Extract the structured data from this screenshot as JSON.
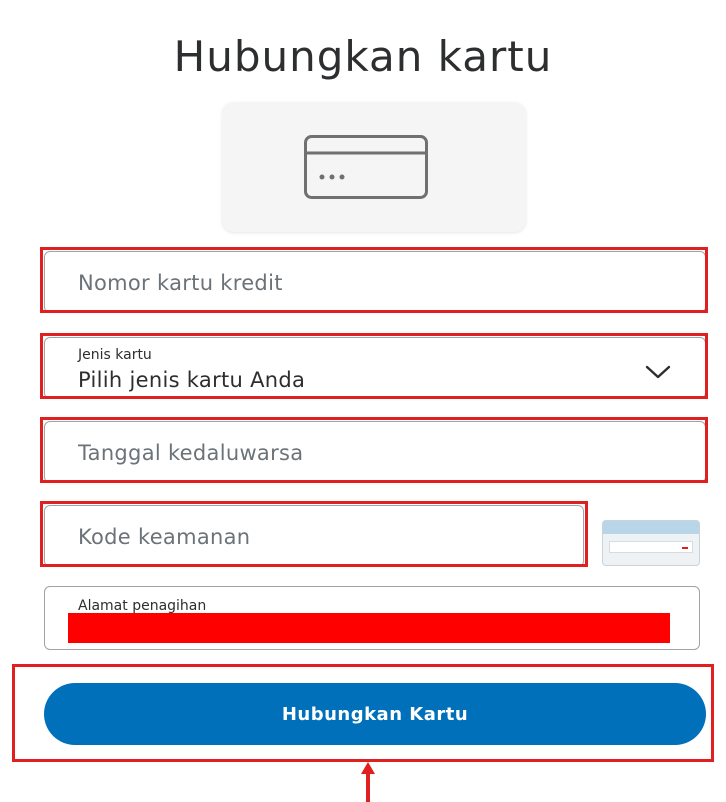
{
  "page": {
    "title": "Hubungkan kartu"
  },
  "form": {
    "card_number_placeholder": "Nomor kartu kredit",
    "card_type": {
      "label": "Jenis kartu",
      "value": "Pilih jenis kartu Anda"
    },
    "expiry_placeholder": "Tanggal kedaluwarsa",
    "security_code_placeholder": "Kode keamanan",
    "billing_address": {
      "label": "Alamat penagihan",
      "value_redacted": true
    },
    "submit_label": "Hubungkan Kartu"
  },
  "icons": {
    "card_tile": "credit-card-icon",
    "security_hint": "card-back-cvv-icon",
    "dropdown": "chevron-down-icon",
    "annotation_arrow": "up-arrow-icon"
  },
  "colors": {
    "primary_button": "#0070ba",
    "highlight_boxes": "#e02020",
    "redaction": "#ff0000",
    "title_text": "#2c2e2f",
    "placeholder_text": "#6c7378"
  }
}
